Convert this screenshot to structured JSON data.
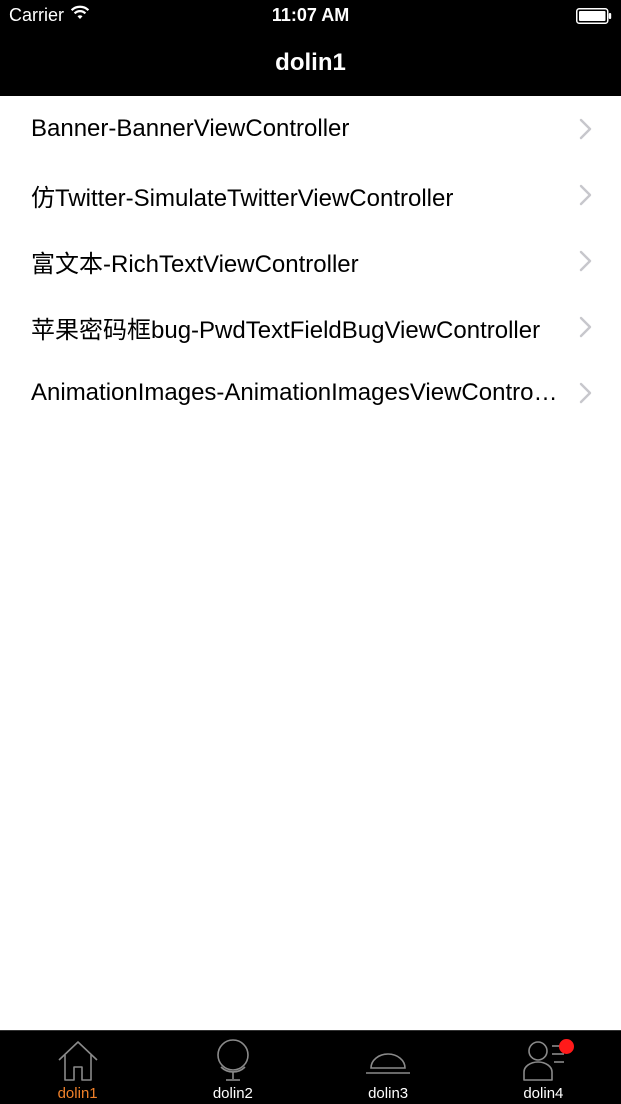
{
  "status_bar": {
    "carrier": "Carrier",
    "time": "11:07 AM"
  },
  "nav": {
    "title": "dolin1"
  },
  "list": {
    "items": [
      {
        "label": "Banner-BannerViewController"
      },
      {
        "label": "仿Twitter-SimulateTwitterViewController"
      },
      {
        "label": "富文本-RichTextViewController"
      },
      {
        "label": "苹果密码框bug-PwdTextFieldBugViewController"
      },
      {
        "label": "AnimationImages-AnimationImagesViewController"
      }
    ]
  },
  "tab_bar": {
    "tabs": [
      {
        "label": "dolin1",
        "icon": "home-icon",
        "active": true
      },
      {
        "label": "dolin2",
        "icon": "globe-icon",
        "active": false
      },
      {
        "label": "dolin3",
        "icon": "dome-icon",
        "active": false
      },
      {
        "label": "dolin4",
        "icon": "profile-icon",
        "active": false,
        "badge": true
      }
    ]
  },
  "colors": {
    "bar_background": "#000000",
    "active_tab": "#f0812a",
    "badge": "#ff1a1a",
    "chevron": "#c7c7cc"
  }
}
